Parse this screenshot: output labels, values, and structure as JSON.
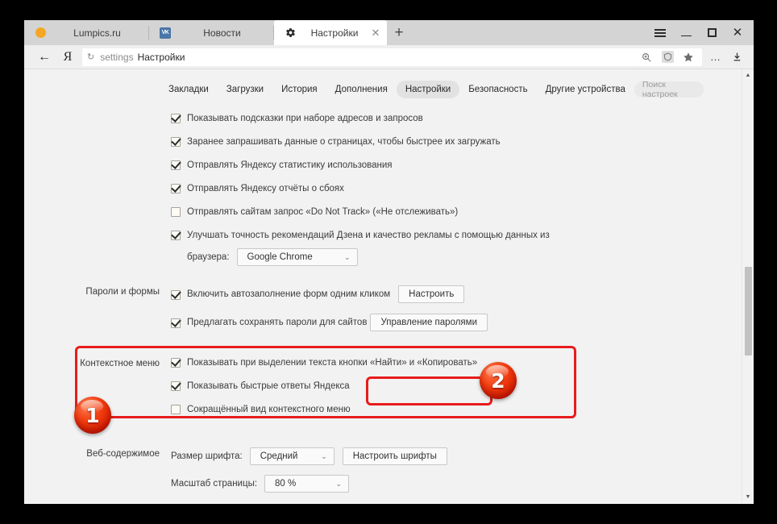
{
  "window": {
    "controls": {
      "menu": "☰",
      "minimize": "—",
      "maximize": "▣",
      "close": "✕"
    }
  },
  "tabs": [
    {
      "title": "Lumpics.ru",
      "favicon": "orange-dot-icon",
      "active": false
    },
    {
      "title": "Новости",
      "favicon": "vk-icon",
      "favicon_text": "VK",
      "active": false
    },
    {
      "title": "Настройки",
      "favicon": "gear-icon",
      "active": true,
      "close": "✕"
    }
  ],
  "newtab_label": "+",
  "addressbar": {
    "back": "←",
    "logo": "Я",
    "reload": "↻",
    "scheme": "settings",
    "title": "Настройки",
    "icons": [
      "search-page-icon",
      "turbo-icon",
      "bookmark-star-icon"
    ],
    "overflow": "…",
    "download": "download-icon"
  },
  "settings_nav": {
    "items": [
      {
        "label": "Закладки",
        "selected": false
      },
      {
        "label": "Загрузки",
        "selected": false
      },
      {
        "label": "История",
        "selected": false
      },
      {
        "label": "Дополнения",
        "selected": false
      },
      {
        "label": "Настройки",
        "selected": true
      },
      {
        "label": "Безопасность",
        "selected": false
      },
      {
        "label": "Другие устройства",
        "selected": false
      }
    ],
    "search_placeholder": "Поиск настроек"
  },
  "top_checkboxes": [
    {
      "label": "Показывать подсказки при наборе адресов и запросов",
      "checked": true
    },
    {
      "label": "Заранее запрашивать данные о страницах, чтобы быстрее их загружать",
      "checked": true
    },
    {
      "label": "Отправлять Яндексу статистику использования",
      "checked": true
    },
    {
      "label": "Отправлять Яндексу отчёты о сбоях",
      "checked": true
    },
    {
      "label": "Отправлять сайтам запрос «Do Not Track» («Не отслеживать»)",
      "checked": false
    },
    {
      "label": "Улучшать точность рекомендаций Дзена и качество рекламы с помощью данных из",
      "checked": true
    }
  ],
  "browser_row": {
    "label": "браузера:",
    "select_value": "Google Chrome",
    "chevron": "⌄"
  },
  "passwords_section": {
    "label": "Пароли и формы",
    "autofill": {
      "label": "Включить автозаполнение форм одним кликом",
      "checked": true,
      "button": "Настроить"
    },
    "save_passwords": {
      "label": "Предлагать сохранять пароли для сайтов",
      "checked": true,
      "button": "Управление паролями"
    }
  },
  "context_menu_section": {
    "label": "Контекстное меню",
    "items": [
      {
        "label": "Показывать при выделении текста кнопки «Найти» и «Копировать»",
        "checked": true
      },
      {
        "label": "Показывать быстрые ответы Яндекса",
        "checked": true
      },
      {
        "label": "Сокращённый вид контекстного меню",
        "checked": false
      }
    ]
  },
  "web_content_section": {
    "label": "Веб-содержимое",
    "font_size": {
      "label": "Размер шрифта:",
      "value": "Средний",
      "chevron": "⌄"
    },
    "font_button": "Настроить шрифты",
    "page_zoom": {
      "label": "Масштаб страницы:",
      "value": "80 %",
      "chevron": "⌄"
    }
  },
  "annotations": [
    {
      "badge": "1",
      "color": "#e81c1c"
    },
    {
      "badge": "2",
      "color": "#e81c1c"
    }
  ],
  "scrollbar": {
    "up": "▲",
    "down": "▼"
  }
}
